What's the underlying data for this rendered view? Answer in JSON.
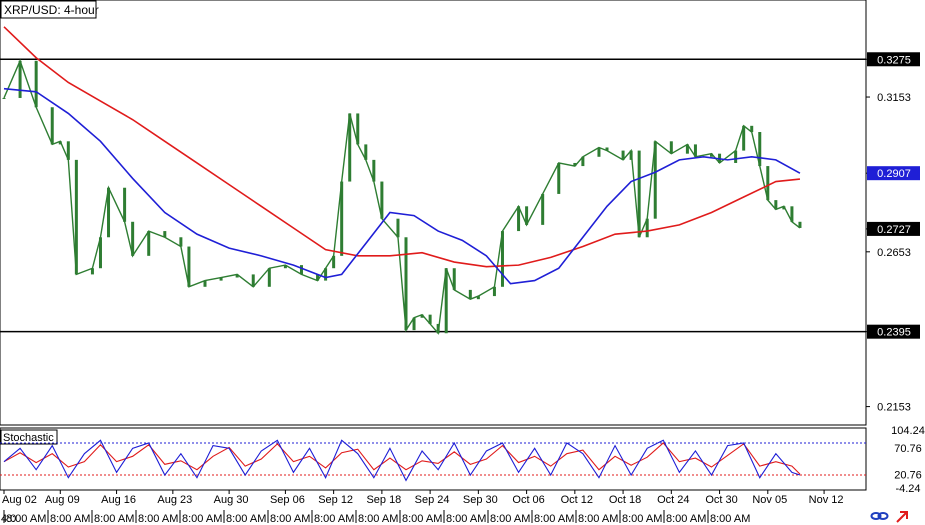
{
  "title": "XRP/USD: 4-hour",
  "colors": {
    "candle": "#2e7d32",
    "sma_fast": "#1f1fd6",
    "sma_slow": "#e01b1b",
    "stoch_k": "#1f1fd6",
    "stoch_d": "#e01b1b",
    "hline": "#000000",
    "price_box": "#000000",
    "current_box": "#1f1fd6"
  },
  "icons": [
    "link-icon",
    "arrow-icon"
  ],
  "chart_data": [
    {
      "type": "candlestick",
      "title": "XRP/USD: 4-hour",
      "x_tick_labels": [
        "Aug 02",
        "Aug 09",
        "Aug 16",
        "Aug 23",
        "Aug 30",
        "Sep 06",
        "Sep 12",
        "Sep 18",
        "Sep 24",
        "Sep 30",
        "Oct 06",
        "Oct 12",
        "Oct 18",
        "Oct 24",
        "Oct 30",
        "Nov 05",
        "Nov 12"
      ],
      "bottom_time_labels": [
        "4:0",
        "8:00 AM",
        "8:00 AM",
        "8:00 AM",
        "8:00 AM",
        "8:00 AM",
        "8:00 AM",
        "8:00 AM",
        "8:00 AM",
        "8:00 AM",
        "8:00 AM",
        "8:00 AM",
        "8:00 AM",
        "8:00 AM",
        "8:00 AM",
        "8:00 AM",
        "8:00 AM",
        "8:00 AM"
      ],
      "y_tick_labels": [
        "0.3275",
        "0.3153",
        "0.2907",
        "0.2727",
        "0.2653",
        "0.2395",
        "0.2153"
      ],
      "ylim": [
        0.21,
        0.346
      ],
      "horizontal_lines": [
        0.3275,
        0.2395
      ],
      "current_price": "0.2727",
      "series": [
        {
          "date": "Aug 02",
          "close": 0.315
        },
        {
          "date": "Aug 04",
          "close": 0.327
        },
        {
          "date": "Aug 06",
          "close": 0.312
        },
        {
          "date": "Aug 08",
          "close": 0.3
        },
        {
          "date": "Aug 09",
          "close": 0.301
        },
        {
          "date": "Aug 10",
          "close": 0.295
        },
        {
          "date": "Aug 11",
          "close": 0.258
        },
        {
          "date": "Aug 13",
          "close": 0.26
        },
        {
          "date": "Aug 14",
          "close": 0.27
        },
        {
          "date": "Aug 15",
          "close": 0.286
        },
        {
          "date": "Aug 17",
          "close": 0.275
        },
        {
          "date": "Aug 18",
          "close": 0.264
        },
        {
          "date": "Aug 20",
          "close": 0.272
        },
        {
          "date": "Aug 22",
          "close": 0.27
        },
        {
          "date": "Aug 24",
          "close": 0.267
        },
        {
          "date": "Aug 25",
          "close": 0.254
        },
        {
          "date": "Aug 27",
          "close": 0.256
        },
        {
          "date": "Aug 29",
          "close": 0.257
        },
        {
          "date": "Aug 31",
          "close": 0.258
        },
        {
          "date": "Sep 02",
          "close": 0.254
        },
        {
          "date": "Sep 04",
          "close": 0.26
        },
        {
          "date": "Sep 06",
          "close": 0.261
        },
        {
          "date": "Sep 08",
          "close": 0.258
        },
        {
          "date": "Sep 10",
          "close": 0.256
        },
        {
          "date": "Sep 11",
          "close": 0.26
        },
        {
          "date": "Sep 12",
          "close": 0.264
        },
        {
          "date": "Sep 13",
          "close": 0.288
        },
        {
          "date": "Sep 14",
          "close": 0.31
        },
        {
          "date": "Sep 15",
          "close": 0.3
        },
        {
          "date": "Sep 16",
          "close": 0.295
        },
        {
          "date": "Sep 17",
          "close": 0.288
        },
        {
          "date": "Sep 18",
          "close": 0.276
        },
        {
          "date": "Sep 20",
          "close": 0.27
        },
        {
          "date": "Sep 21",
          "close": 0.24
        },
        {
          "date": "Sep 22",
          "close": 0.244
        },
        {
          "date": "Sep 23",
          "close": 0.245
        },
        {
          "date": "Sep 24",
          "close": 0.242
        },
        {
          "date": "Sep 25",
          "close": 0.239
        },
        {
          "date": "Sep 26",
          "close": 0.26
        },
        {
          "date": "Sep 27",
          "close": 0.253
        },
        {
          "date": "Sep 29",
          "close": 0.25
        },
        {
          "date": "Sep 30",
          "close": 0.251
        },
        {
          "date": "Oct 02",
          "close": 0.254
        },
        {
          "date": "Oct 03",
          "close": 0.272
        },
        {
          "date": "Oct 05",
          "close": 0.28
        },
        {
          "date": "Oct 06",
          "close": 0.274
        },
        {
          "date": "Oct 08",
          "close": 0.284
        },
        {
          "date": "Oct 10",
          "close": 0.294
        },
        {
          "date": "Oct 12",
          "close": 0.293
        },
        {
          "date": "Oct 13",
          "close": 0.296
        },
        {
          "date": "Oct 15",
          "close": 0.299
        },
        {
          "date": "Oct 16",
          "close": 0.298
        },
        {
          "date": "Oct 18",
          "close": 0.295
        },
        {
          "date": "Oct 19",
          "close": 0.298
        },
        {
          "date": "Oct 20",
          "close": 0.27
        },
        {
          "date": "Oct 21",
          "close": 0.276
        },
        {
          "date": "Oct 22",
          "close": 0.301
        },
        {
          "date": "Oct 24",
          "close": 0.297
        },
        {
          "date": "Oct 26",
          "close": 0.3
        },
        {
          "date": "Oct 27",
          "close": 0.296
        },
        {
          "date": "Oct 29",
          "close": 0.297
        },
        {
          "date": "Oct 30",
          "close": 0.294
        },
        {
          "date": "Nov 01",
          "close": 0.298
        },
        {
          "date": "Nov 02",
          "close": 0.306
        },
        {
          "date": "Nov 03",
          "close": 0.304
        },
        {
          "date": "Nov 04",
          "close": 0.293
        },
        {
          "date": "Nov 05",
          "close": 0.282
        },
        {
          "date": "Nov 06",
          "close": 0.279
        },
        {
          "date": "Nov 07",
          "close": 0.28
        },
        {
          "date": "Nov 08",
          "close": 0.275
        },
        {
          "date": "Nov 09",
          "close": 0.273
        }
      ],
      "sma_fast": [
        {
          "date": "Aug 02",
          "value": 0.318
        },
        {
          "date": "Aug 06",
          "value": 0.317
        },
        {
          "date": "Aug 10",
          "value": 0.31
        },
        {
          "date": "Aug 14",
          "value": 0.301
        },
        {
          "date": "Aug 18",
          "value": 0.289
        },
        {
          "date": "Aug 22",
          "value": 0.278
        },
        {
          "date": "Aug 26",
          "value": 0.271
        },
        {
          "date": "Aug 30",
          "value": 0.2665
        },
        {
          "date": "Sep 03",
          "value": 0.264
        },
        {
          "date": "Sep 07",
          "value": 0.261
        },
        {
          "date": "Sep 11",
          "value": 0.257
        },
        {
          "date": "Sep 13",
          "value": 0.258
        },
        {
          "date": "Sep 16",
          "value": 0.268
        },
        {
          "date": "Sep 19",
          "value": 0.278
        },
        {
          "date": "Sep 22",
          "value": 0.277
        },
        {
          "date": "Sep 25",
          "value": 0.272
        },
        {
          "date": "Sep 28",
          "value": 0.269
        },
        {
          "date": "Oct 01",
          "value": 0.264
        },
        {
          "date": "Oct 04",
          "value": 0.255
        },
        {
          "date": "Oct 07",
          "value": 0.256
        },
        {
          "date": "Oct 10",
          "value": 0.26
        },
        {
          "date": "Oct 13",
          "value": 0.27
        },
        {
          "date": "Oct 16",
          "value": 0.28
        },
        {
          "date": "Oct 19",
          "value": 0.288
        },
        {
          "date": "Oct 22",
          "value": 0.291
        },
        {
          "date": "Oct 25",
          "value": 0.295
        },
        {
          "date": "Oct 28",
          "value": 0.296
        },
        {
          "date": "Oct 31",
          "value": 0.295
        },
        {
          "date": "Nov 03",
          "value": 0.296
        },
        {
          "date": "Nov 06",
          "value": 0.295
        },
        {
          "date": "Nov 09",
          "value": 0.2907
        }
      ],
      "sma_slow": [
        {
          "date": "Aug 02",
          "value": 0.338
        },
        {
          "date": "Aug 06",
          "value": 0.328
        },
        {
          "date": "Aug 10",
          "value": 0.32
        },
        {
          "date": "Aug 14",
          "value": 0.314
        },
        {
          "date": "Aug 18",
          "value": 0.308
        },
        {
          "date": "Aug 22",
          "value": 0.301
        },
        {
          "date": "Aug 26",
          "value": 0.294
        },
        {
          "date": "Aug 30",
          "value": 0.287
        },
        {
          "date": "Sep 03",
          "value": 0.28
        },
        {
          "date": "Sep 07",
          "value": 0.273
        },
        {
          "date": "Sep 11",
          "value": 0.266
        },
        {
          "date": "Sep 15",
          "value": 0.264
        },
        {
          "date": "Sep 19",
          "value": 0.264
        },
        {
          "date": "Sep 23",
          "value": 0.265
        },
        {
          "date": "Sep 27",
          "value": 0.262
        },
        {
          "date": "Oct 01",
          "value": 0.2605
        },
        {
          "date": "Oct 05",
          "value": 0.261
        },
        {
          "date": "Oct 09",
          "value": 0.2635
        },
        {
          "date": "Oct 13",
          "value": 0.267
        },
        {
          "date": "Oct 17",
          "value": 0.271
        },
        {
          "date": "Oct 21",
          "value": 0.272
        },
        {
          "date": "Oct 25",
          "value": 0.274
        },
        {
          "date": "Oct 29",
          "value": 0.278
        },
        {
          "date": "Nov 02",
          "value": 0.283
        },
        {
          "date": "Nov 06",
          "value": 0.288
        },
        {
          "date": "Nov 09",
          "value": 0.2888
        }
      ]
    },
    {
      "type": "line",
      "title": "Stochastic",
      "ylim": [
        -4.24,
        104.24
      ],
      "y_tick_labels": [
        "104.24",
        "70.76",
        "20.76",
        "-4.24"
      ],
      "levels": [
        80,
        20
      ],
      "series": [
        {
          "date": "Aug 02",
          "value": 45
        },
        {
          "date": "Aug 04",
          "value": 70
        },
        {
          "date": "Aug 06",
          "value": 30
        },
        {
          "date": "Aug 08",
          "value": 75
        },
        {
          "date": "Aug 10",
          "value": 15
        },
        {
          "date": "Aug 12",
          "value": 60
        },
        {
          "date": "Aug 14",
          "value": 85
        },
        {
          "date": "Aug 16",
          "value": 25
        },
        {
          "date": "Aug 18",
          "value": 70
        },
        {
          "date": "Aug 20",
          "value": 80
        },
        {
          "date": "Aug 22",
          "value": 20
        },
        {
          "date": "Aug 24",
          "value": 60
        },
        {
          "date": "Aug 26",
          "value": 15
        },
        {
          "date": "Aug 28",
          "value": 75
        },
        {
          "date": "Aug 30",
          "value": 70
        },
        {
          "date": "Sep 01",
          "value": 20
        },
        {
          "date": "Sep 03",
          "value": 65
        },
        {
          "date": "Sep 05",
          "value": 85
        },
        {
          "date": "Sep 07",
          "value": 25
        },
        {
          "date": "Sep 09",
          "value": 70
        },
        {
          "date": "Sep 11",
          "value": 15
        },
        {
          "date": "Sep 13",
          "value": 85
        },
        {
          "date": "Sep 15",
          "value": 60
        },
        {
          "date": "Sep 17",
          "value": 15
        },
        {
          "date": "Sep 19",
          "value": 70
        },
        {
          "date": "Sep 21",
          "value": 10
        },
        {
          "date": "Sep 23",
          "value": 65
        },
        {
          "date": "Sep 25",
          "value": 30
        },
        {
          "date": "Sep 27",
          "value": 80
        },
        {
          "date": "Sep 29",
          "value": 20
        },
        {
          "date": "Oct 01",
          "value": 65
        },
        {
          "date": "Oct 03",
          "value": 80
        },
        {
          "date": "Oct 05",
          "value": 25
        },
        {
          "date": "Oct 07",
          "value": 70
        },
        {
          "date": "Oct 09",
          "value": 20
        },
        {
          "date": "Oct 11",
          "value": 80
        },
        {
          "date": "Oct 13",
          "value": 60
        },
        {
          "date": "Oct 15",
          "value": 15
        },
        {
          "date": "Oct 17",
          "value": 75
        },
        {
          "date": "Oct 19",
          "value": 20
        },
        {
          "date": "Oct 21",
          "value": 70
        },
        {
          "date": "Oct 23",
          "value": 85
        },
        {
          "date": "Oct 25",
          "value": 25
        },
        {
          "date": "Oct 27",
          "value": 65
        },
        {
          "date": "Oct 29",
          "value": 20
        },
        {
          "date": "Oct 31",
          "value": 75
        },
        {
          "date": "Nov 02",
          "value": 80
        },
        {
          "date": "Nov 04",
          "value": 15
        },
        {
          "date": "Nov 06",
          "value": 60
        },
        {
          "date": "Nov 08",
          "value": 25
        },
        {
          "date": "Nov 09",
          "value": 20
        }
      ]
    }
  ]
}
